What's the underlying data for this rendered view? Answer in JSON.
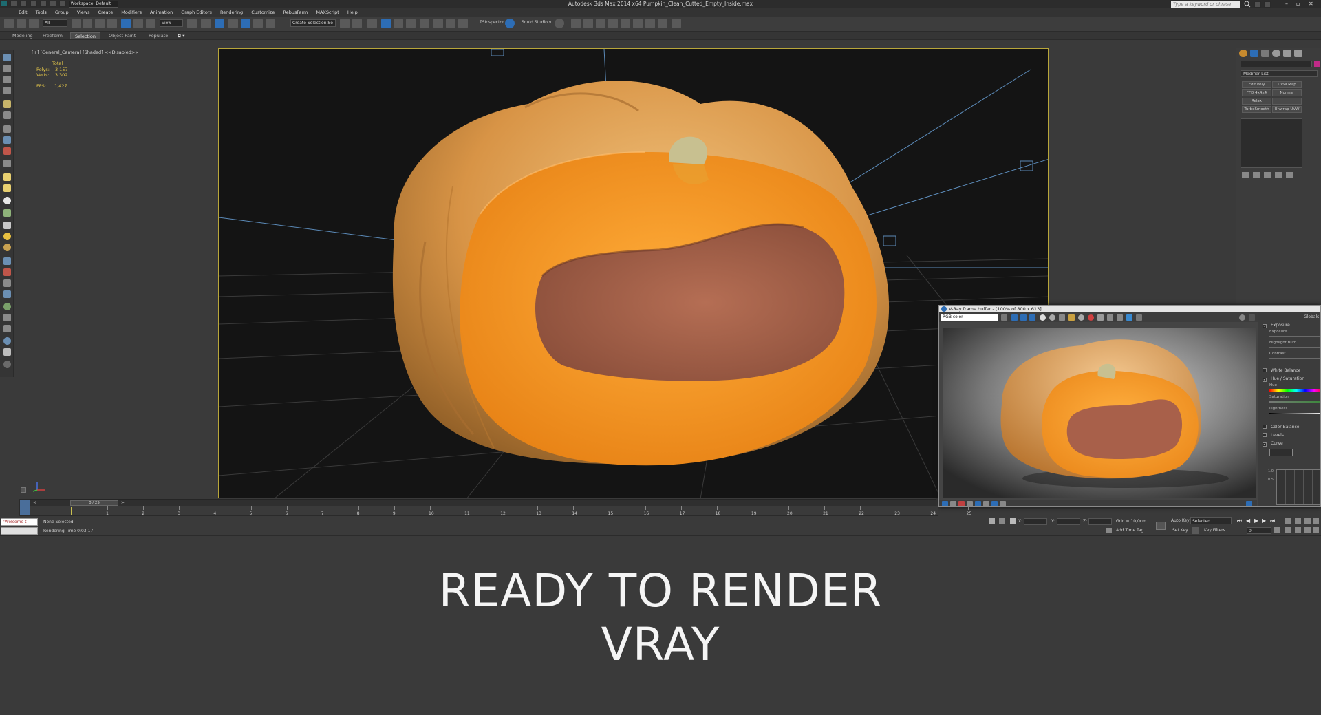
{
  "window": {
    "title": "Autodesk 3ds Max  2014 x64    Pumpkin_Clean_Cutted_Empty_Inside.max",
    "workspace_label": "Workspace: Default",
    "search_placeholder": "Type a keyword or phrase"
  },
  "menu": [
    "Edit",
    "Tools",
    "Group",
    "Views",
    "Create",
    "Modifiers",
    "Animation",
    "Graph Editors",
    "Rendering",
    "Customize",
    "RebusFarm",
    "MAXScript",
    "Help"
  ],
  "toolbar": {
    "filter_value": "All",
    "view_value": "View",
    "selection_set": "Create Selection Se",
    "ts_label": "TSInspector",
    "squid_label": "Squid Studio v"
  },
  "ribbon": {
    "tabs": [
      "Modeling",
      "Freeform",
      "Selection",
      "Object Paint",
      "Populate"
    ],
    "active": "Selection"
  },
  "viewport": {
    "label": "[+] [General_Camera] [Shaded] <<Disabled>>",
    "stats": {
      "total_label": "Total",
      "polys_label": "Polys:",
      "polys_value": "3 157",
      "verts_label": "Verts:",
      "verts_value": "3 302",
      "fps_label": "FPS:",
      "fps_value": "1,427"
    }
  },
  "command_panel": {
    "modifier_list": "Modifier List",
    "buttons": [
      "Edit Poly",
      "UVW Map",
      "FFD 4x4x4",
      "Normal",
      "Relax",
      "",
      "TurboSmooth",
      "Unwrap UVW"
    ]
  },
  "vfb": {
    "title": "V-Ray frame buffer - [100% of 800 x 613]",
    "channel": "RGB color",
    "panel_label": "Globals",
    "sections": [
      {
        "label": "Exposure",
        "checked": true
      },
      {
        "label": "White Balance",
        "checked": false
      },
      {
        "label": "Hue / Saturation",
        "checked": true
      },
      {
        "label": "Color Balance",
        "checked": false
      },
      {
        "label": "Levels",
        "checked": false
      },
      {
        "label": "Curve",
        "checked": true
      }
    ],
    "sliders": [
      "Exposure",
      "Highlight Burn",
      "Contrast",
      "Hue",
      "Saturation",
      "Lightness"
    ],
    "curve_values": [
      "1.0",
      "0.5"
    ]
  },
  "timeline": {
    "position": "0 / 25",
    "ticks": [
      "1",
      "2",
      "3",
      "4",
      "5",
      "6",
      "7",
      "8",
      "9",
      "10",
      "11",
      "12",
      "13",
      "14",
      "15",
      "16",
      "17",
      "18",
      "19",
      "20",
      "21",
      "22",
      "23",
      "24",
      "25"
    ]
  },
  "status": {
    "maxscript": "\"Welcome t",
    "selection": "None Selected",
    "render_time": "Rendering Time  0:03:17",
    "x_label": "X:",
    "y_label": "Y:",
    "z_label": "Z:",
    "grid": "Grid = 10,0cm",
    "add_time_tag": "Add Time Tag",
    "auto_key": "Auto Key",
    "set_key": "Set Key",
    "selected": "Selected",
    "key_filters": "Key Filters...",
    "frame": "0"
  },
  "caption": {
    "line1": "READY TO RENDER",
    "line2": "VRAY"
  },
  "colors": {
    "pumpkin_skin": "#d99a4a",
    "pumpkin_flesh": "#f08a1a",
    "pumpkin_inside": "#a8604a",
    "frame_border": "#b8a63a",
    "stats": "#e6c84a"
  }
}
